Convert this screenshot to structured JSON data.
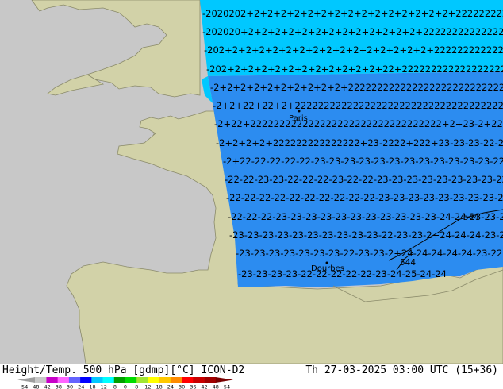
{
  "title": {
    "left": "Height/Temp. 500 hPa [gdmp][°C] ICON-D2",
    "right": "Th 27-03-2025 03:00 UTC (15+36)"
  },
  "colors": {
    "sea": "#c8c8c8",
    "land": "#d2d2a8",
    "coast": "#8a8a6a",
    "band_cyan": "#00c8ff",
    "band_blue": "#2c8cf0",
    "contour_text": "#000000"
  },
  "cities": [
    {
      "name": "Paris"
    },
    {
      "name": "Dourbes"
    }
  ],
  "contours": [
    {
      "label": "544"
    },
    {
      "label": "544"
    }
  ],
  "rows": [
    {
      "text": "-2020202+2+2+2+2+2+2+2+2+2+2+2+2+2+2+2+22222222222"
    },
    {
      "text": "-202020+2+2+2+2+2+2+2+2+2+2+2+2+2+22222222222222222222"
    },
    {
      "text": "-202+2+2+2+2+2+2+2+2+2+2+2+2+2+2+2+2222222222222222222"
    },
    {
      "text": "-202+2+2+2+2+2+2+2+2+2+2+2+22+2222222222222222222222"
    },
    {
      "text": "-2+2+2+2+2+2+2+2+2+2+222222222222222222222222222222"
    },
    {
      "text": "-2+2+22+22+2+22222222222222222222222222222222222222"
    },
    {
      "text": "-2+22+222222222222222222222222222222222+2+23-2+22+222"
    },
    {
      "text": "-2+2+2+2+222222222222222+23-2222+222+23-23-23-22-23-23"
    },
    {
      "text": "-2+22-22-22-22-22-23-23-23-23-23-23-23-23-23-23-23-23-22"
    },
    {
      "text": "-22-22-23-23-22-22-22-23-22-22-23-23-23-23-23-23-23-23-22"
    },
    {
      "text": "-22-22-22-22-22-22-22-22-22-22-23-23-23-23-23-23-23-23-23"
    },
    {
      "text": "-22-22-22-23-23-23-23-23-23-23-23-23-23-23-24-24-23-23-22-23"
    },
    {
      "text": "-23-23-23-23-23-23-23-23-23-23-22-23-23-2+24-24-24-23-22"
    },
    {
      "text": "-23-23-23-23-23-23-23-22-23-23-2+24-24-24-24-24-23-22"
    },
    {
      "text": "-23-23-23-23-22-22-22-22-22-23-24-25-24-24"
    }
  ],
  "colorbar": {
    "ticks": [
      "-54",
      "-48",
      "-42",
      "-38",
      "-30",
      "-24",
      "-18",
      "-12",
      "-8",
      "0",
      "8",
      "12",
      "18",
      "24",
      "30",
      "36",
      "42",
      "48",
      "54"
    ],
    "colors": [
      "#9e9e9e",
      "#c8c8c8",
      "#c800c8",
      "#ff64ff",
      "#6464ff",
      "#0000ff",
      "#00c8ff",
      "#00ffff",
      "#00a000",
      "#00dc00",
      "#a0e632",
      "#ffff00",
      "#ffc800",
      "#ff8c00",
      "#ff0000",
      "#c80000",
      "#a00000",
      "#780000"
    ]
  }
}
